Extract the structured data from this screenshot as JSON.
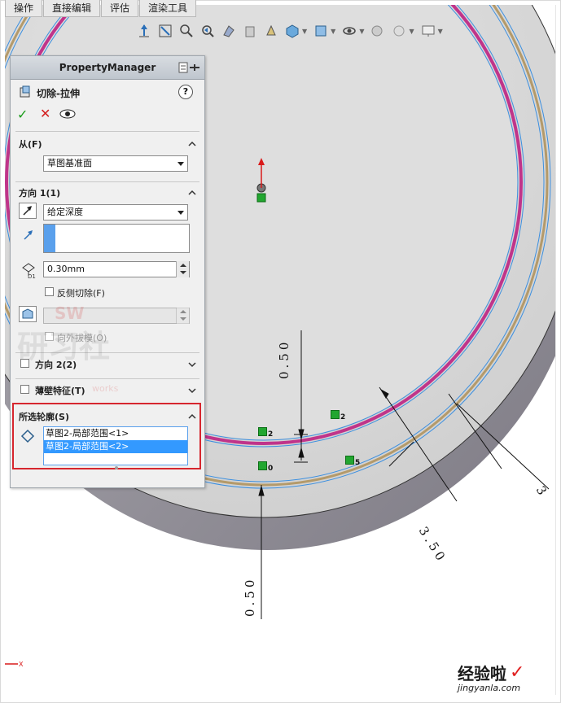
{
  "tabs": [
    "操作",
    "直接编辑",
    "评估",
    "渲染工具"
  ],
  "hud_icons": [
    "view-orientation-icon",
    "zoom-to-fit-icon",
    "zoom-area-icon",
    "previous-view-icon",
    "section-view-icon",
    "dynamic-annotation-icon",
    "display-style-icon",
    "hide-show-items-icon",
    "edit-appearance-icon",
    "apply-scene-icon",
    "view-settings-icon",
    "display-pane-icon"
  ],
  "property_manager": {
    "title": "PropertyManager",
    "feature_title": "切除-拉伸",
    "help_label": "?",
    "from": {
      "label": "从(F)",
      "value": "草图基准面"
    },
    "direction1": {
      "label": "方向 1(1)",
      "end_condition": "给定深度",
      "depth": "0.30mm",
      "depth_symbol": "D1",
      "flip_side_label": "反侧切除(F)",
      "draft_outward_label": "向外拔模(O)"
    },
    "direction2": {
      "label": "方向 2(2)"
    },
    "thin_feature": {
      "label": "薄壁特征(T)"
    },
    "selected_contours": {
      "label": "所选轮廓(S)",
      "items": [
        "草图2-局部范围<1>",
        "草图2-局部范围<2>"
      ]
    },
    "watermark": {
      "top": "SW",
      "main": "研习社",
      "sub": "works"
    }
  },
  "dimensions": {
    "top_vertical": "0.50",
    "bottom_vertical": "0.50",
    "diagonal": "3.50",
    "diagonal_partial": "3"
  },
  "markers": {
    "m1": "2",
    "m2": "2",
    "m3": "0",
    "m4": "5"
  },
  "colors": {
    "highlight_box": "#d6262e",
    "list_selection": "#3399ff",
    "magenta_edge": "#c0348a",
    "tan_edge": "#b49a6a",
    "blue_edge": "#3b8fe0"
  },
  "watermark_site": {
    "brand": "经验啦",
    "url": "jingyanla.com"
  }
}
